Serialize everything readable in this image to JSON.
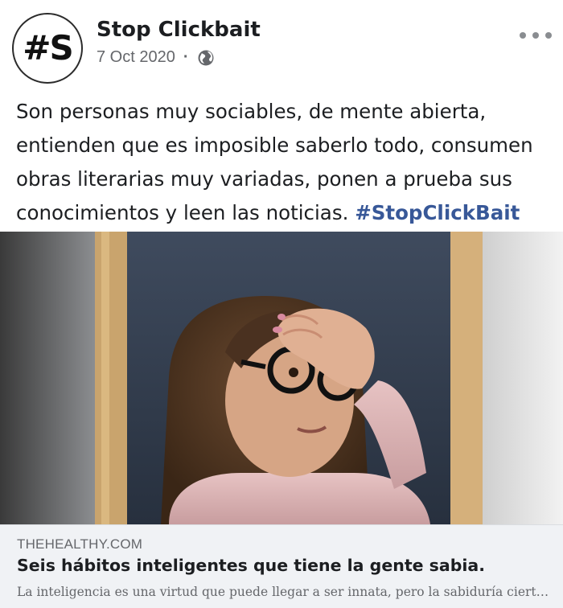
{
  "post": {
    "avatar_text": "#S",
    "page_name": "Stop Clickbait",
    "date": "7 Oct 2020",
    "separator": "·",
    "privacy_icon": "globe-icon",
    "menu_icon": "more-options-icon",
    "text": "Son personas muy sociables, de mente abierta, entienden que es imposible saberlo todo, consumen obras literarias muy variadas, ponen a prueba sus conocimientos y leen las noticias.",
    "hashtag": "#StopClickBait"
  },
  "photo": {
    "subject": "photo"
  },
  "link_preview": {
    "domain": "THEHEALTHY.COM",
    "title": "Seis hábitos inteligentes que tiene la gente sabia.",
    "description": "La inteligencia es una virtud que puede llegar a ser innata, pero la sabiduría ciertamente se adquiere con el tiempo"
  },
  "colors": {
    "hashtag": "#385898",
    "link_card_bg": "#f0f2f5",
    "meta_text": "#65676b"
  }
}
